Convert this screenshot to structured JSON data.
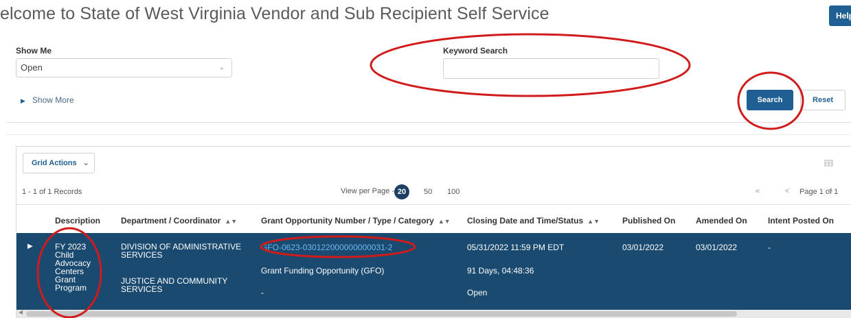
{
  "header": {
    "title": "elcome to State of West Virginia Vendor and Sub Recipient Self Service",
    "help_label": "Help"
  },
  "filters": {
    "show_me_label": "Show Me",
    "show_me_value": "Open",
    "keyword_label": "Keyword Search",
    "keyword_value": "",
    "show_more_label": "Show More",
    "search_label": "Search",
    "reset_label": "Reset"
  },
  "grid": {
    "actions_label": "Grid Actions",
    "records_text": "1 - 1 of 1 Records",
    "view_per_page_label": "View per Page -",
    "page_sizes": [
      "20",
      "50",
      "100"
    ],
    "page_size_selected": "20",
    "page_text": "Page 1 of 1",
    "columns": [
      "Description",
      "Department / Coordinator",
      "Grant Opportunity Number / Type / Category",
      "Closing Date and Time/Status",
      "Published On",
      "Amended On",
      "Intent Posted On"
    ],
    "rows": [
      {
        "description_lines": [
          "FY 2023",
          "Child",
          "Advocacy",
          "Centers",
          "Grant",
          "Program"
        ],
        "department_1": "DIVISION OF ADMINISTRATIVE SERVICES",
        "department_1_lines": [
          "DIVISION OF ADMINISTRATIVE",
          "SERVICES"
        ],
        "department_2_lines": [
          "JUSTICE AND COMMUNITY",
          "SERVICES"
        ],
        "grant_number": "GFO-0623-030122000000000031-2",
        "grant_type": "Grant Funding Opportunity (GFO)",
        "grant_category": "-",
        "closing_date": "05/31/2022 11:59 PM EDT",
        "time_remaining": "91 Days, 04:48:36",
        "status": "Open",
        "published_on": "03/01/2022",
        "amended_on": "03/01/2022",
        "intent_posted_on": "-"
      }
    ]
  },
  "colors": {
    "primary": "#1f5f94",
    "row_selected": "#1b4a70",
    "link": "#6cb8f0",
    "annotation": "#d11a1a"
  },
  "icons": {
    "select_chevron": "chevron-down-icon",
    "show_more": "triangle-right-icon",
    "grid_columns": "grid-columns-icon",
    "first_page": "double-chevron-left-icon",
    "prev_page": "chevron-left-icon",
    "next_page": "chevron-right-icon",
    "sort": "sort-icon",
    "expand_row": "triangle-right-icon"
  }
}
